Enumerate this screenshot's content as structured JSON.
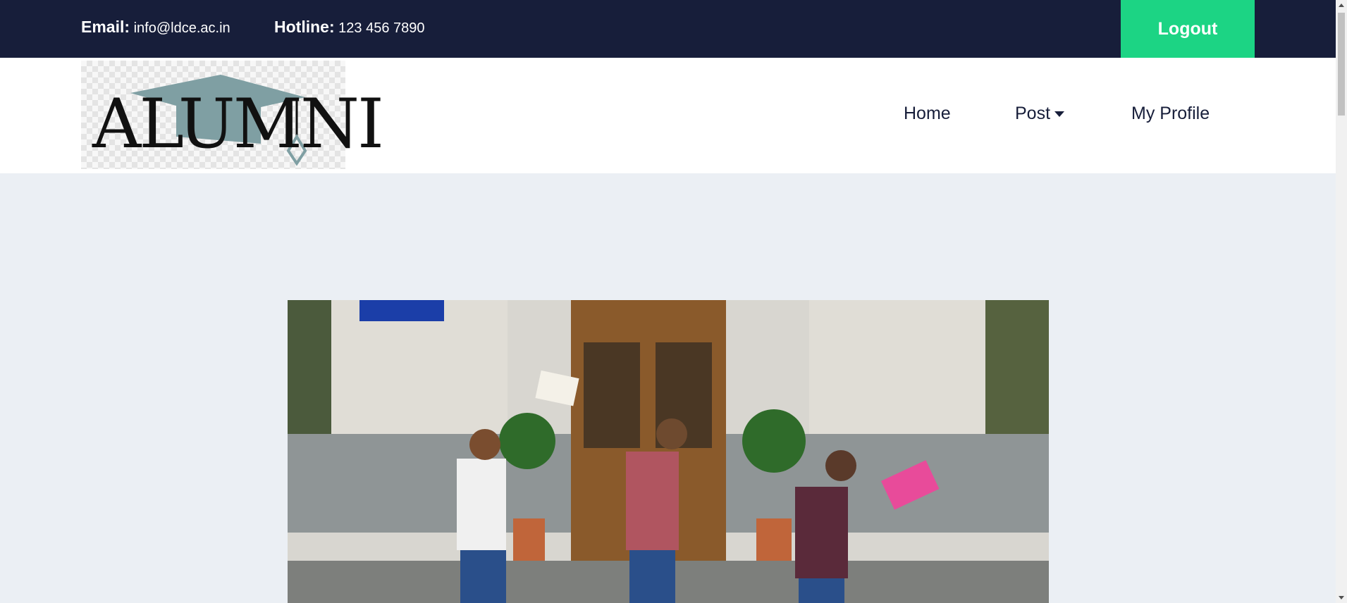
{
  "topbar": {
    "email_label": "Email:",
    "email_value": "info@ldce.ac.in",
    "hotline_label": "Hotline:",
    "hotline_value": "123 456 7890",
    "logout_label": "Logout"
  },
  "logo": {
    "text": "ALUMNI"
  },
  "nav": {
    "home": "Home",
    "post": "Post",
    "profile": "My Profile"
  },
  "colors": {
    "topbar_bg": "#171e3a",
    "logout_bg": "#1cd484",
    "page_bg": "#ebeff4",
    "logo_cap": "#7f9fa3"
  },
  "icons": {
    "post_dropdown": "caret-down-icon",
    "logo_mark": "graduation-cap-icon"
  },
  "hero": {
    "image": "students jumping in front of school building"
  }
}
